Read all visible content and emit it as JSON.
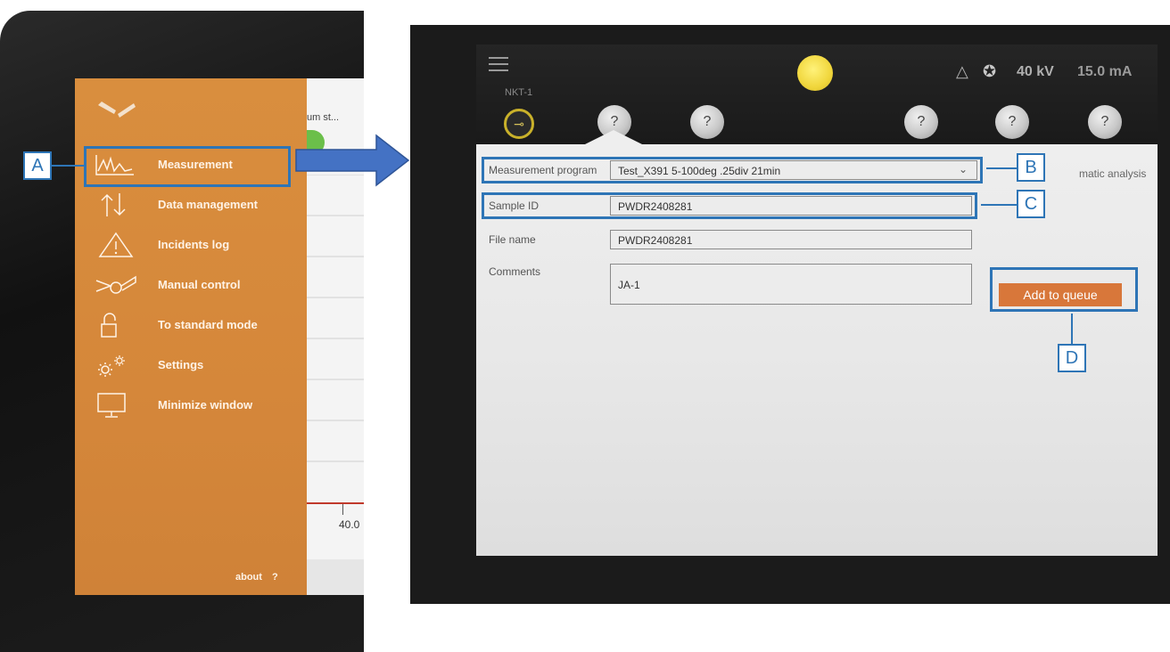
{
  "left_screen": {
    "partial_text": "um st...",
    "axis_label": "40.0",
    "menu": {
      "items": [
        {
          "label": "Measurement",
          "icon": "measurement-chart-icon"
        },
        {
          "label": "Data management",
          "icon": "transfer-arrows-icon"
        },
        {
          "label": "Incidents log",
          "icon": "warning-icon"
        },
        {
          "label": "Manual control",
          "icon": "goniometer-icon"
        },
        {
          "label": "To standard mode",
          "icon": "unlock-icon"
        },
        {
          "label": "Settings",
          "icon": "gears-icon"
        },
        {
          "label": "Minimize window",
          "icon": "monitor-icon"
        }
      ],
      "about": "about",
      "help": "?"
    }
  },
  "right_screen": {
    "device_name": "NKT-1",
    "status": {
      "voltage": "40 kV",
      "current": "15.0 mA"
    },
    "positions": [
      "?",
      "?",
      "?",
      "?",
      "?"
    ],
    "form": {
      "program_label": "Measurement program",
      "program_value": "Test_X391 5-100deg .25div 21min",
      "sample_label": "Sample ID",
      "sample_value": "PWDR2408281",
      "file_label": "File name",
      "file_value": "PWDR2408281",
      "comments_label": "Comments",
      "comments_value": "JA-1",
      "auto_analysis_text": "matic analysis",
      "add_button": "Add to queue"
    }
  },
  "annotations": {
    "a": "A",
    "b": "B",
    "c": "C",
    "d": "D"
  },
  "colors": {
    "menu_orange": "#d98e3e",
    "annotation_blue": "#2e75b6",
    "button_orange": "#d8773a"
  }
}
